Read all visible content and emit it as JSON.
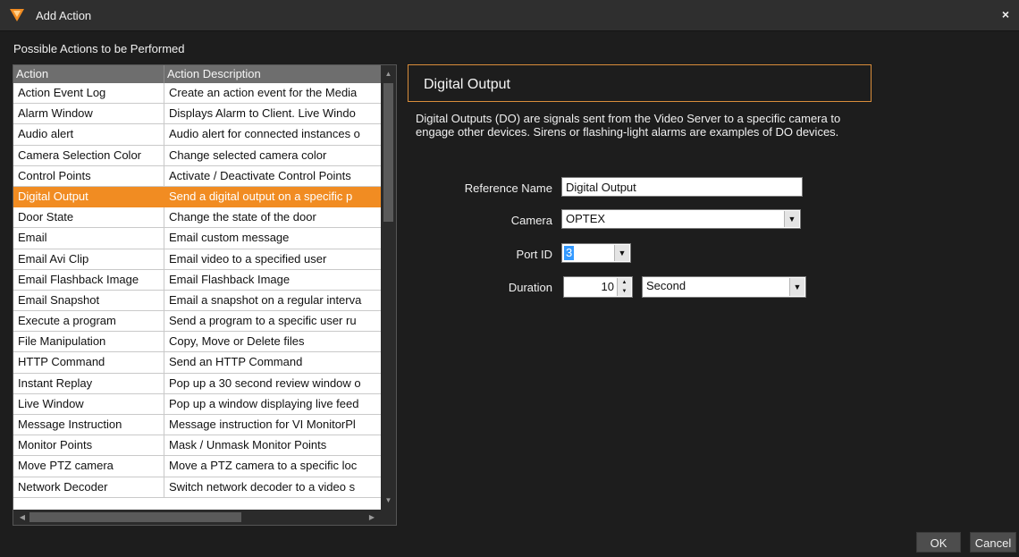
{
  "window": {
    "title": "Add Action",
    "logo_icon": "orange-shield-logo",
    "close_glyph": "×"
  },
  "left": {
    "section_label": "Possible Actions to be Performed",
    "columns": [
      "Action",
      "Action Description"
    ],
    "selected_index": 5,
    "rows": [
      {
        "action": "Action Event Log",
        "description": "Create an action event for the Media"
      },
      {
        "action": "Alarm Window",
        "description": "Displays Alarm to Client.  Live Windo"
      },
      {
        "action": "Audio alert",
        "description": "Audio alert for connected instances o"
      },
      {
        "action": "Camera Selection Color",
        "description": "Change selected camera color"
      },
      {
        "action": "Control Points",
        "description": "Activate / Deactivate Control Points"
      },
      {
        "action": "Digital Output",
        "description": "Send a digital output on a specific p"
      },
      {
        "action": "Door State",
        "description": "Change the state of the door"
      },
      {
        "action": "Email",
        "description": "Email custom message"
      },
      {
        "action": "Email Avi Clip",
        "description": "Email video to a specified user"
      },
      {
        "action": "Email Flashback Image",
        "description": "Email Flashback Image"
      },
      {
        "action": "Email Snapshot",
        "description": "Email a snapshot on a regular interva"
      },
      {
        "action": "Execute a program",
        "description": "Send a program to a specific user ru"
      },
      {
        "action": "File Manipulation",
        "description": "Copy, Move or Delete files"
      },
      {
        "action": "HTTP Command",
        "description": "Send an HTTP Command"
      },
      {
        "action": "Instant Replay",
        "description": "Pop up a 30 second review window o"
      },
      {
        "action": "Live Window",
        "description": "Pop up a window displaying live feed"
      },
      {
        "action": "Message Instruction",
        "description": "Message instruction for VI MonitorPl"
      },
      {
        "action": "Monitor Points",
        "description": "Mask / Unmask Monitor Points"
      },
      {
        "action": "Move PTZ camera",
        "description": "Move a PTZ camera to a specific loc"
      },
      {
        "action": "Network Decoder",
        "description": "Switch network decoder to a video s"
      }
    ]
  },
  "right": {
    "header_title": "Digital Output",
    "description": "Digital Outputs (DO) are signals sent from the Video Server to a specific camera to engage other devices.  Sirens or flashing-light alarms are examples of DO devices.",
    "reference_name": {
      "label": "Reference Name",
      "value": "Digital Output"
    },
    "camera": {
      "label": "Camera",
      "value": "OPTEX"
    },
    "port_id": {
      "label": "Port ID",
      "value": "3"
    },
    "duration": {
      "label": "Duration",
      "value": "10",
      "unit": "Second"
    }
  },
  "footer": {
    "ok_label": "OK",
    "cancel_label": "Cancel"
  },
  "colors": {
    "accent_orange": "#f18c22",
    "background": "#1d1d1d",
    "selection_blue": "#3399ff"
  }
}
